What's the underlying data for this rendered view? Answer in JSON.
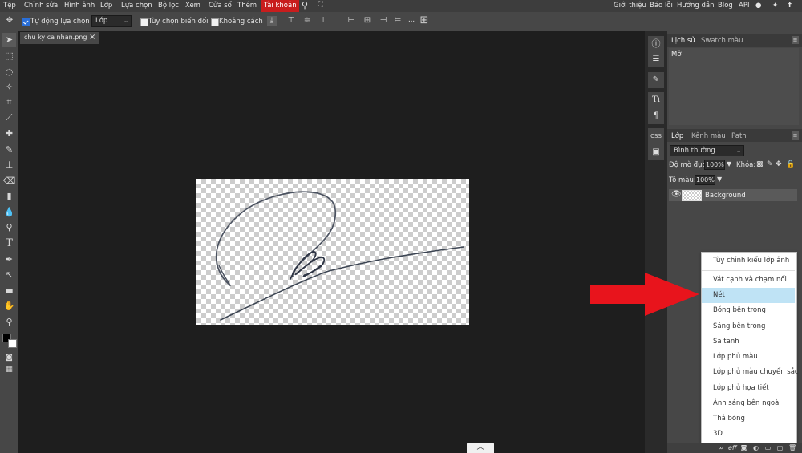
{
  "menubar": {
    "left_items": [
      "Tệp",
      "Chỉnh sửa",
      "Hình ảnh",
      "Lớp",
      "Lựa chọn",
      "Bộ lọc",
      "Xem",
      "Cửa sổ",
      "Thêm",
      "Tài khoản"
    ],
    "right_items": [
      "Giới thiệu",
      "Báo lỗi",
      "Hướng dẫn",
      "Blog",
      "API"
    ],
    "accent_color": "#c81d1d"
  },
  "options": {
    "auto_select_label": "Tự động lựa chọn",
    "auto_select_checked": true,
    "target_value": "Lớp",
    "transform_label": "Tùy chọn biến đổi",
    "spacing_label": "Khoảng cách",
    "more_label": "..."
  },
  "document": {
    "tab_title": "chu ky ca nhan.png",
    "close_glyph": "×"
  },
  "history_panel": {
    "tabs": [
      "Lịch sử",
      "Swatch màu"
    ],
    "items": [
      "Mở"
    ]
  },
  "layers_panel": {
    "tabs": [
      "Lớp",
      "Kênh màu",
      "Path"
    ],
    "blend_mode": "Bình thường",
    "opacity_label": "Độ mờ đục:",
    "opacity_value": "100%",
    "lock_label": "Khóa:",
    "fill_label": "Tô màu:",
    "fill_value": "100%",
    "layers": [
      {
        "name": "Background",
        "visible": true
      }
    ]
  },
  "context_menu": {
    "items": [
      "Tùy chỉnh kiểu lớp ảnh",
      "Vát cạnh và chạm nổi",
      "Nét",
      "Bóng bên trong",
      "Sáng bên trong",
      "Sa tanh",
      "Lớp phủ màu",
      "Lớp phủ màu chuyển sắc",
      "Lớp phủ họa tiết",
      "Ánh sáng bên ngoài",
      "Thả bóng",
      "3D"
    ],
    "highlighted": "Nét",
    "highlight_color": "#bfe3f5"
  },
  "annotation": {
    "arrow_color": "#e8141c"
  },
  "icons": {
    "toolbar": [
      "move-icon",
      "marquee-icon",
      "lasso-icon",
      "magic-wand-icon",
      "crop-icon",
      "eyedropper-icon",
      "healing-icon",
      "brush-icon",
      "stamp-icon",
      "eraser-icon",
      "gradient-icon",
      "blur-icon",
      "dodge-icon",
      "type-icon",
      "pen-icon",
      "path-select-icon",
      "shape-icon",
      "hand-icon",
      "zoom-icon"
    ],
    "right_column": [
      "info-icon",
      "brush-settings-icon",
      "character-icon",
      "paragraph-icon",
      "css-icon",
      "image-icon"
    ]
  }
}
